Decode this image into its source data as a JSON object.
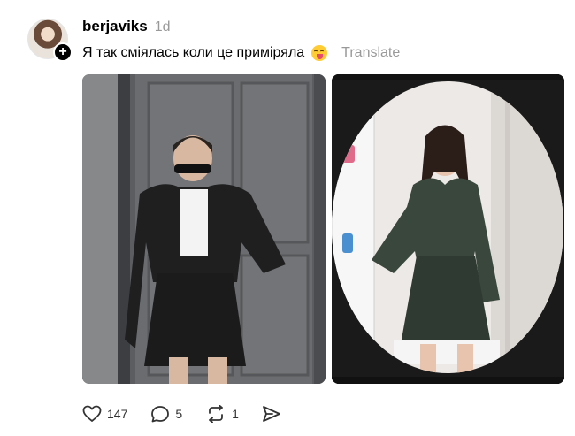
{
  "post": {
    "username": "berjaviks",
    "time": "1d",
    "caption": "Я так сміялась коли це приміряла",
    "caption_emoji": "squinting-tongue-emoji",
    "translate_label": "Translate",
    "follow_badge": "+"
  },
  "actions": {
    "like_count": "147",
    "comment_count": "5",
    "repost_count": "1"
  },
  "colors": {
    "muted": "#999999",
    "text": "#000000",
    "badge": "#000000"
  }
}
